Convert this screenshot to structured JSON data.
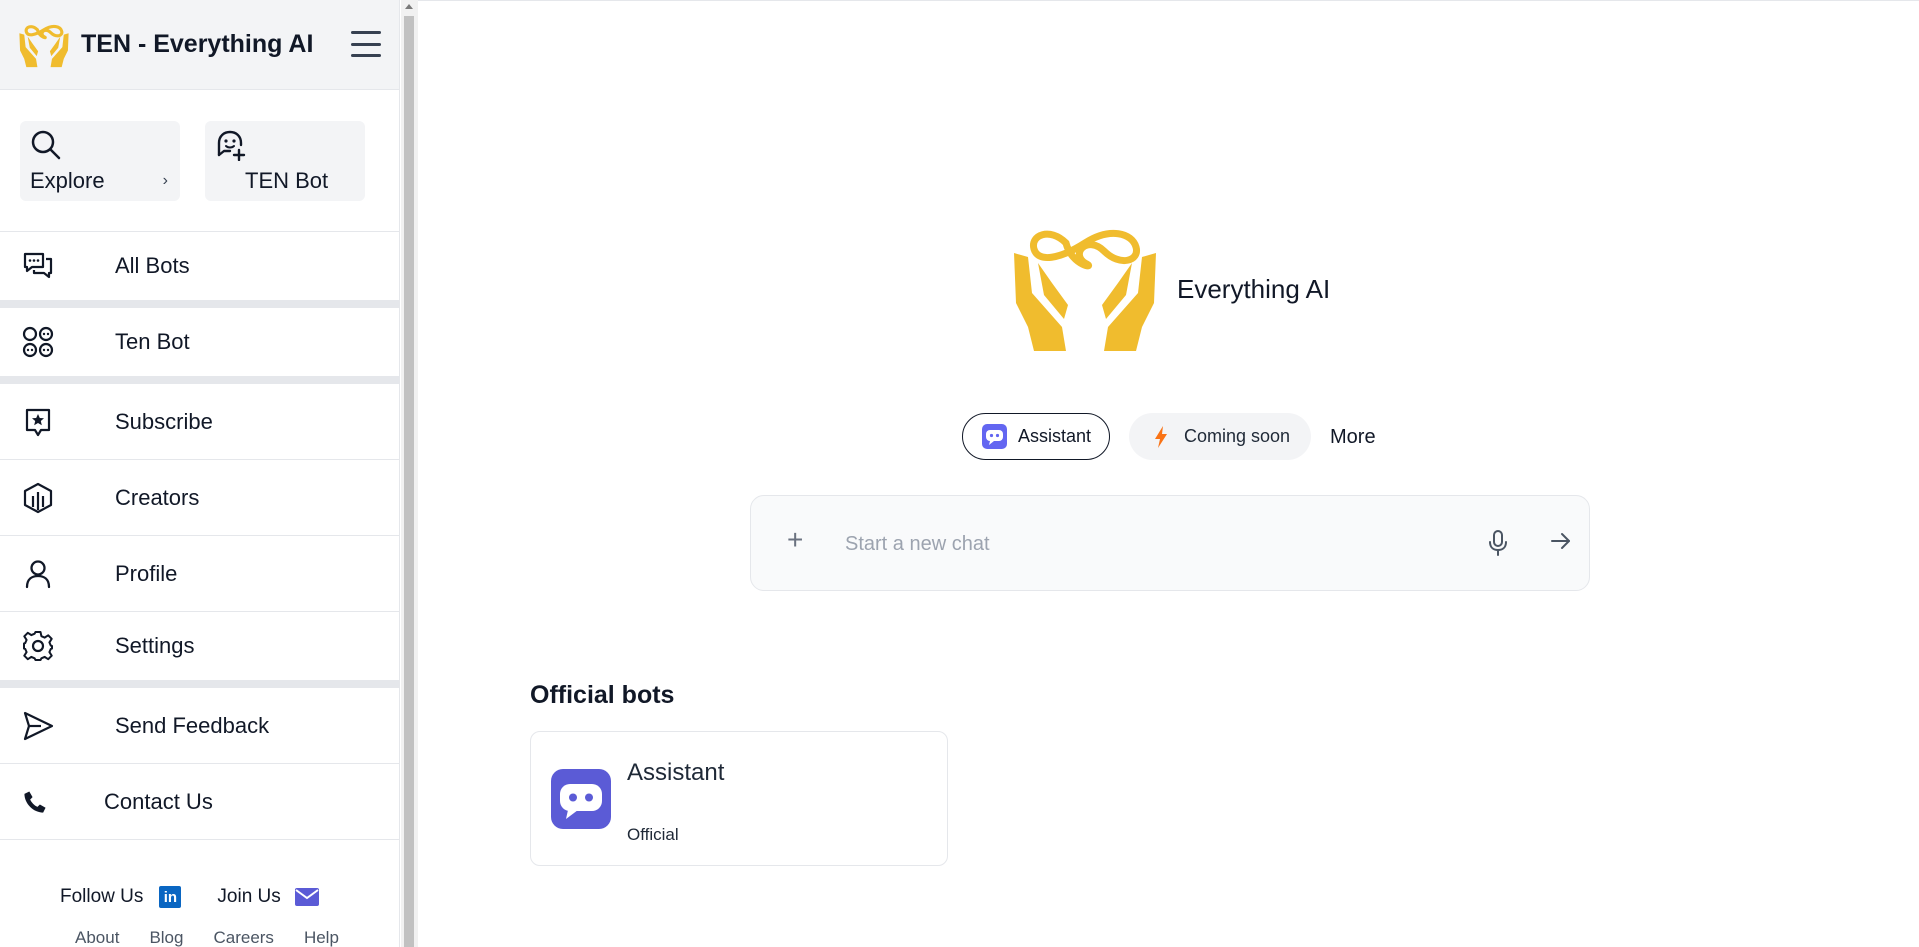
{
  "sidebar": {
    "brand": "TEN - Everything AI",
    "quick_actions": [
      {
        "label": "Explore",
        "icon": "search-icon"
      },
      {
        "label": "TEN Bot",
        "icon": "bot-add-icon"
      }
    ],
    "items": [
      {
        "label": "All Bots",
        "icon": "chat-bubbles-icon"
      },
      {
        "label": "Ten Bot",
        "icon": "bot-grid-icon"
      },
      {
        "label": "Subscribe",
        "icon": "star-badge-icon"
      },
      {
        "label": "Creators",
        "icon": "creators-icon"
      },
      {
        "label": "Profile",
        "icon": "user-icon"
      },
      {
        "label": "Settings",
        "icon": "gear-icon"
      },
      {
        "label": "Send Feedback",
        "icon": "send-icon"
      },
      {
        "label": "Contact Us",
        "icon": "phone-icon"
      }
    ],
    "footer": {
      "follow_label": "Follow Us",
      "linkedin_text": "in",
      "join_label": "Join Us",
      "links": [
        "About",
        "Blog",
        "Careers",
        "Help Center"
      ]
    }
  },
  "main": {
    "hero_title": "Everything AI",
    "chips": [
      {
        "label": "Assistant",
        "selected": true
      },
      {
        "label": "Coming soon",
        "selected": false
      }
    ],
    "more_label": "More",
    "chat": {
      "placeholder": "Start a new chat",
      "value": ""
    },
    "official_bots": {
      "title": "Official bots",
      "bots": [
        {
          "name": "Assistant",
          "tag": "Official"
        }
      ]
    }
  },
  "colors": {
    "brand_gold": "#f0bc2e",
    "bot_purple": "#5b5bd6",
    "bolt_orange": "#f97316",
    "linkedin_blue": "#0a66c2",
    "mail_purple": "#5b5bd6"
  }
}
